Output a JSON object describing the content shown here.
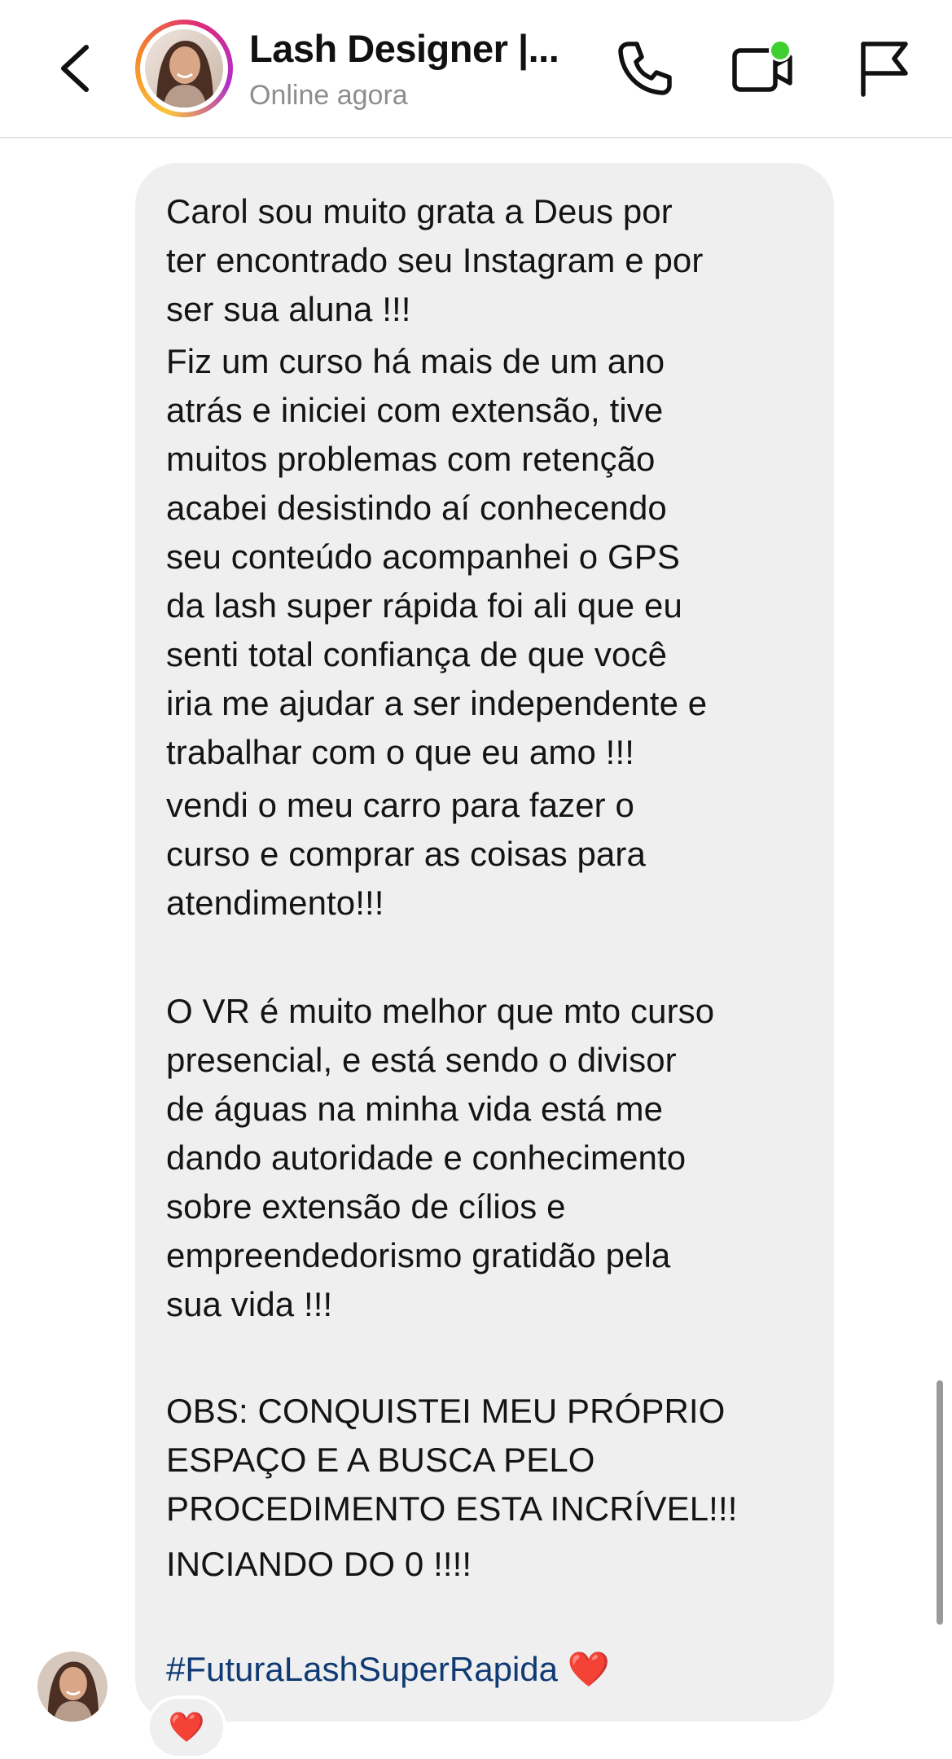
{
  "header": {
    "contact_name": "Lash Designer |...",
    "status": "Online agora"
  },
  "message": {
    "paragraphs": [
      "Carol sou muito grata a Deus por\nter encontrado seu Instagram e por\nser sua aluna !!!",
      "Fiz um curso há mais de um ano\natrás e iniciei com extensão, tive\nmuitos problemas com retenção\nacabei desistindo aí conhecendo\nseu conteúdo acompanhei o GPS\nda lash super rápida foi ali que eu\nsenti total confiança de que você\niria me ajudar a ser independente e\ntrabalhar com o que eu amo !!!",
      "vendi o meu carro para fazer o\ncurso e comprar as coisas para\natendimento!!!",
      "O VR é muito melhor que mto curso\npresencial, e está sendo o divisor\nde águas na minha vida está me\ndando autoridade e conhecimento\nsobre extensão de cílios e\nempreendedorismo gratidão pela\nsua vida !!!",
      "OBS: CONQUISTEI MEU PRÓPRIO\nESPAÇO E A BUSCA PELO\nPROCEDIMENTO ESTA INCRÍVEL!!!",
      "INCIANDO DO 0 !!!!"
    ],
    "hashtag": "#FuturaLashSuperRapida",
    "emoji": "❤️"
  },
  "reaction": {
    "emoji": "❤️"
  },
  "icons": {
    "back": "chevron-left-icon",
    "call": "phone-icon",
    "video": "video-camera-icon",
    "report": "flag-icon"
  },
  "colors": {
    "bubble": "#efefef",
    "hashtag": "#0f3a73",
    "status_dot": "#3fcf2f",
    "secondary_text": "#8e8e8e"
  }
}
